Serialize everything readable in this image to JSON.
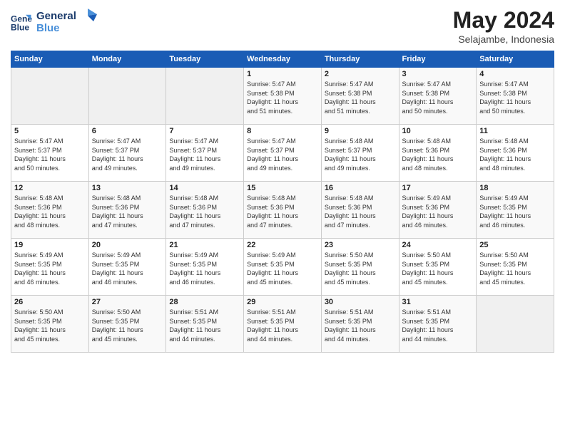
{
  "logo": {
    "line1": "General",
    "line2": "Blue"
  },
  "title": "May 2024",
  "location": "Selajambe, Indonesia",
  "days_of_week": [
    "Sunday",
    "Monday",
    "Tuesday",
    "Wednesday",
    "Thursday",
    "Friday",
    "Saturday"
  ],
  "weeks": [
    [
      {
        "day": "",
        "info": ""
      },
      {
        "day": "",
        "info": ""
      },
      {
        "day": "",
        "info": ""
      },
      {
        "day": "1",
        "info": "Sunrise: 5:47 AM\nSunset: 5:38 PM\nDaylight: 11 hours\nand 51 minutes."
      },
      {
        "day": "2",
        "info": "Sunrise: 5:47 AM\nSunset: 5:38 PM\nDaylight: 11 hours\nand 51 minutes."
      },
      {
        "day": "3",
        "info": "Sunrise: 5:47 AM\nSunset: 5:38 PM\nDaylight: 11 hours\nand 50 minutes."
      },
      {
        "day": "4",
        "info": "Sunrise: 5:47 AM\nSunset: 5:38 PM\nDaylight: 11 hours\nand 50 minutes."
      }
    ],
    [
      {
        "day": "5",
        "info": "Sunrise: 5:47 AM\nSunset: 5:37 PM\nDaylight: 11 hours\nand 50 minutes."
      },
      {
        "day": "6",
        "info": "Sunrise: 5:47 AM\nSunset: 5:37 PM\nDaylight: 11 hours\nand 49 minutes."
      },
      {
        "day": "7",
        "info": "Sunrise: 5:47 AM\nSunset: 5:37 PM\nDaylight: 11 hours\nand 49 minutes."
      },
      {
        "day": "8",
        "info": "Sunrise: 5:47 AM\nSunset: 5:37 PM\nDaylight: 11 hours\nand 49 minutes."
      },
      {
        "day": "9",
        "info": "Sunrise: 5:48 AM\nSunset: 5:37 PM\nDaylight: 11 hours\nand 49 minutes."
      },
      {
        "day": "10",
        "info": "Sunrise: 5:48 AM\nSunset: 5:36 PM\nDaylight: 11 hours\nand 48 minutes."
      },
      {
        "day": "11",
        "info": "Sunrise: 5:48 AM\nSunset: 5:36 PM\nDaylight: 11 hours\nand 48 minutes."
      }
    ],
    [
      {
        "day": "12",
        "info": "Sunrise: 5:48 AM\nSunset: 5:36 PM\nDaylight: 11 hours\nand 48 minutes."
      },
      {
        "day": "13",
        "info": "Sunrise: 5:48 AM\nSunset: 5:36 PM\nDaylight: 11 hours\nand 47 minutes."
      },
      {
        "day": "14",
        "info": "Sunrise: 5:48 AM\nSunset: 5:36 PM\nDaylight: 11 hours\nand 47 minutes."
      },
      {
        "day": "15",
        "info": "Sunrise: 5:48 AM\nSunset: 5:36 PM\nDaylight: 11 hours\nand 47 minutes."
      },
      {
        "day": "16",
        "info": "Sunrise: 5:48 AM\nSunset: 5:36 PM\nDaylight: 11 hours\nand 47 minutes."
      },
      {
        "day": "17",
        "info": "Sunrise: 5:49 AM\nSunset: 5:36 PM\nDaylight: 11 hours\nand 46 minutes."
      },
      {
        "day": "18",
        "info": "Sunrise: 5:49 AM\nSunset: 5:35 PM\nDaylight: 11 hours\nand 46 minutes."
      }
    ],
    [
      {
        "day": "19",
        "info": "Sunrise: 5:49 AM\nSunset: 5:35 PM\nDaylight: 11 hours\nand 46 minutes."
      },
      {
        "day": "20",
        "info": "Sunrise: 5:49 AM\nSunset: 5:35 PM\nDaylight: 11 hours\nand 46 minutes."
      },
      {
        "day": "21",
        "info": "Sunrise: 5:49 AM\nSunset: 5:35 PM\nDaylight: 11 hours\nand 46 minutes."
      },
      {
        "day": "22",
        "info": "Sunrise: 5:49 AM\nSunset: 5:35 PM\nDaylight: 11 hours\nand 45 minutes."
      },
      {
        "day": "23",
        "info": "Sunrise: 5:50 AM\nSunset: 5:35 PM\nDaylight: 11 hours\nand 45 minutes."
      },
      {
        "day": "24",
        "info": "Sunrise: 5:50 AM\nSunset: 5:35 PM\nDaylight: 11 hours\nand 45 minutes."
      },
      {
        "day": "25",
        "info": "Sunrise: 5:50 AM\nSunset: 5:35 PM\nDaylight: 11 hours\nand 45 minutes."
      }
    ],
    [
      {
        "day": "26",
        "info": "Sunrise: 5:50 AM\nSunset: 5:35 PM\nDaylight: 11 hours\nand 45 minutes."
      },
      {
        "day": "27",
        "info": "Sunrise: 5:50 AM\nSunset: 5:35 PM\nDaylight: 11 hours\nand 45 minutes."
      },
      {
        "day": "28",
        "info": "Sunrise: 5:51 AM\nSunset: 5:35 PM\nDaylight: 11 hours\nand 44 minutes."
      },
      {
        "day": "29",
        "info": "Sunrise: 5:51 AM\nSunset: 5:35 PM\nDaylight: 11 hours\nand 44 minutes."
      },
      {
        "day": "30",
        "info": "Sunrise: 5:51 AM\nSunset: 5:35 PM\nDaylight: 11 hours\nand 44 minutes."
      },
      {
        "day": "31",
        "info": "Sunrise: 5:51 AM\nSunset: 5:35 PM\nDaylight: 11 hours\nand 44 minutes."
      },
      {
        "day": "",
        "info": ""
      }
    ]
  ]
}
